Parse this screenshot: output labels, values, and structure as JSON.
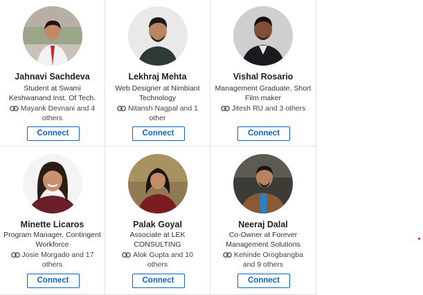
{
  "cards": [
    {
      "name": "Jahnavi Sachdeva",
      "headline": "Student at Swami Keshwanand Inst. Of Tech.",
      "shared": "Mayank Devnani and 4 others",
      "connect_label": "Connect"
    },
    {
      "name": "Lekhraj Mehta",
      "headline": "Web Designer at Nimbiant Technology",
      "shared": "Nitansh Nagpal and 1 other",
      "connect_label": "Connect"
    },
    {
      "name": "Vishal Rosario",
      "headline": "Management Graduate, Short Film maker",
      "shared": "Jitesh RU and 3 others",
      "connect_label": "Connect"
    },
    {
      "name": "Minette Licaros",
      "headline": "Program Manager, Contingent Workforce",
      "shared": "Josie Morgado and 17 others",
      "connect_label": "Connect"
    },
    {
      "name": "Palak Goyal",
      "headline": "Associate at LEK CONSULTING",
      "shared": "Alok Gupta and 10 others",
      "connect_label": "Connect"
    },
    {
      "name": "Neeraj Dalal",
      "headline": "Co-Owner at Forever Management Solutions",
      "shared": "Kehinde Orogbangba and 9 others",
      "connect_label": "Connect"
    }
  ],
  "colors": {
    "accent": "#0a66c2",
    "name_text": "#1f1f1f",
    "border": "#e2e2e2"
  },
  "icons": {
    "shared_connection": "shared-connections-icon",
    "avatar": "profile-photo"
  }
}
